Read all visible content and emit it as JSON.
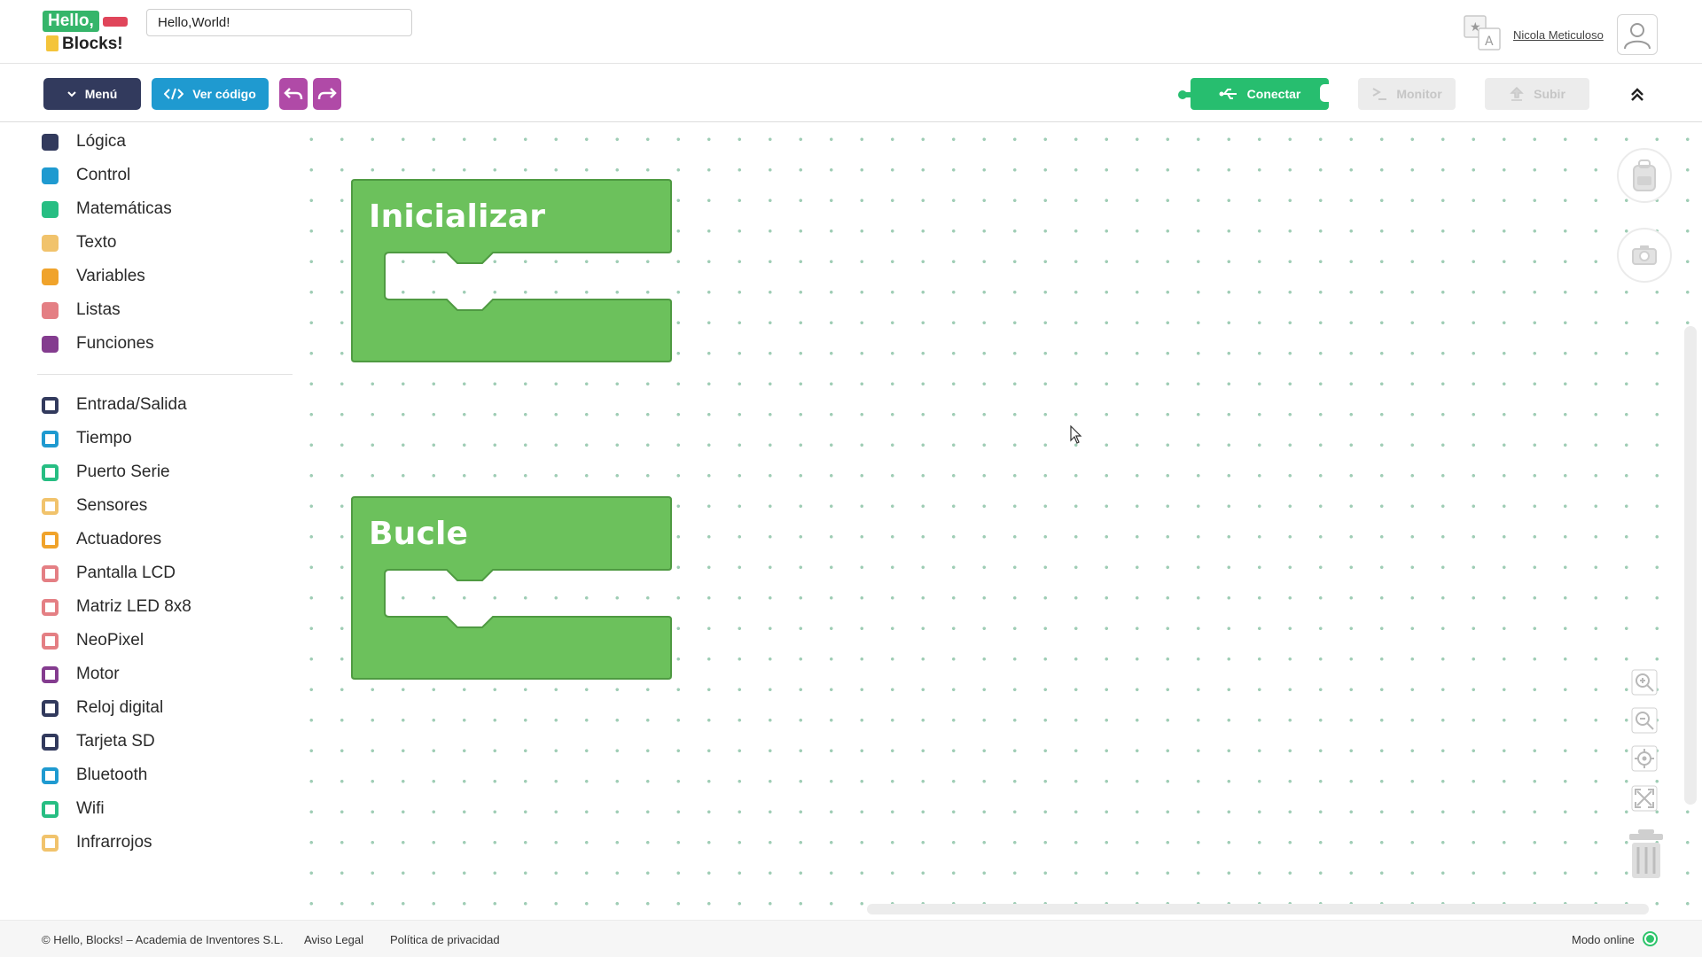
{
  "header": {
    "logo_line1": "Hello,",
    "logo_line2": "Blocks!",
    "project_name": "Hello,World!",
    "user_name": "Nicola Meticuloso"
  },
  "toolbar": {
    "menu_label": "Menú",
    "code_label": "Ver código",
    "connect_label": "Conectar",
    "monitor_label": "Monitor",
    "upload_label": "Subir"
  },
  "sidebar": {
    "basic_categories": [
      {
        "label": "Lógica",
        "color": "#323a5d"
      },
      {
        "label": "Control",
        "color": "#1f9ad0"
      },
      {
        "label": "Matemáticas",
        "color": "#27be83"
      },
      {
        "label": "Texto",
        "color": "#f1c36c"
      },
      {
        "label": "Variables",
        "color": "#f0a32b"
      },
      {
        "label": "Listas",
        "color": "#e47f84"
      },
      {
        "label": "Funciones",
        "color": "#843c8f"
      }
    ],
    "hardware_categories": [
      {
        "label": "Entrada/Salida",
        "color": "#323a5d"
      },
      {
        "label": "Tiempo",
        "color": "#1f9ad0"
      },
      {
        "label": "Puerto Serie",
        "color": "#27be83"
      },
      {
        "label": "Sensores",
        "color": "#f1c36c"
      },
      {
        "label": "Actuadores",
        "color": "#f0a32b"
      },
      {
        "label": "Pantalla LCD",
        "color": "#e47f84"
      },
      {
        "label": "Matriz LED 8x8",
        "color": "#e47f84"
      },
      {
        "label": "NeoPixel",
        "color": "#e47f84"
      },
      {
        "label": "Motor",
        "color": "#843c8f"
      },
      {
        "label": "Reloj digital",
        "color": "#323a5d"
      },
      {
        "label": "Tarjeta SD",
        "color": "#323a5d"
      },
      {
        "label": "Bluetooth",
        "color": "#1f9ad0"
      },
      {
        "label": "Wifi",
        "color": "#27be83"
      },
      {
        "label": "Infrarrojos",
        "color": "#f1c36c"
      }
    ]
  },
  "workspace": {
    "blocks": [
      {
        "title": "Inicializar",
        "color": "#6cc15c"
      },
      {
        "title": "Bucle",
        "color": "#6cc15c"
      }
    ]
  },
  "footer": {
    "copyright": "© Hello, Blocks! – Academia de Inventores S.L.",
    "legal": "Aviso Legal",
    "privacy": "Política de privacidad",
    "mode": "Modo online"
  }
}
